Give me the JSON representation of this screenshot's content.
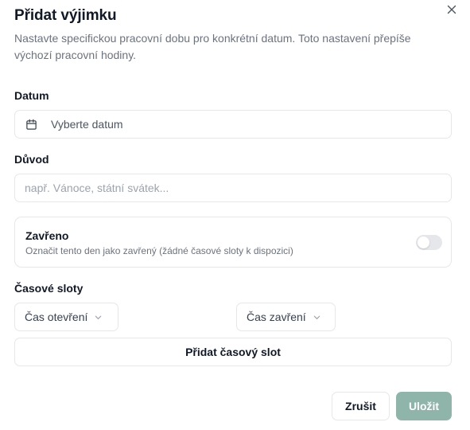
{
  "dialog": {
    "title": "Přidat výjimku",
    "description": "Nastavte specifickou pracovní dobu pro konkrétní datum. Toto nastavení přepíše výchozí pracovní hodiny.",
    "close_icon": "close-icon"
  },
  "date": {
    "label": "Datum",
    "value": "Vyberte datum",
    "icon": "calendar-icon"
  },
  "reason": {
    "label": "Důvod",
    "value": "",
    "placeholder": "např. Vánoce, státní svátek..."
  },
  "closed": {
    "title": "Zavřeno",
    "description": "Označit tento den jako zavřený (žádné časové sloty k dispozici)",
    "enabled": false
  },
  "time_slots": {
    "label": "Časové sloty",
    "open_select": "Čas otevření",
    "close_select": "Čas zavření",
    "add_button": "Přidat časový slot"
  },
  "actions": {
    "cancel": "Zrušit",
    "save": "Uložit"
  },
  "colors": {
    "save_button": "#8fb5aa",
    "border": "#e5e7eb",
    "muted_text": "#6b7280"
  }
}
